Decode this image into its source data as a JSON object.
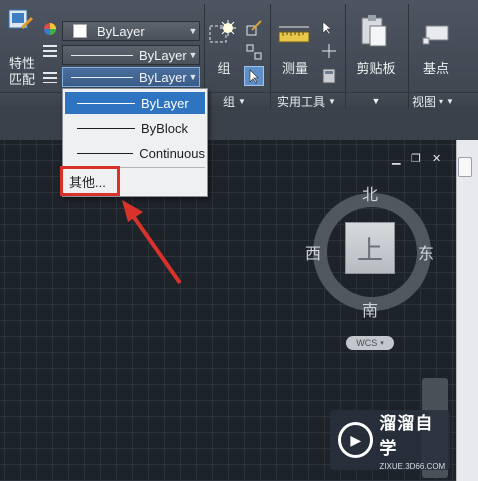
{
  "ribbon": {
    "match_properties_label_line1": "特性",
    "match_properties_label_line2": "匹配",
    "color_combo": {
      "value": "ByLayer"
    },
    "linetype_combo": {
      "value": "ByLayer"
    },
    "lineweight_combo": {
      "value": "ByLayer"
    },
    "group_label": "组",
    "measure_label": "测量",
    "clipboard_label": "剪贴板",
    "basepoint_label": "基点",
    "panels": {
      "group_panel": "组",
      "utilities_panel": "实用工具",
      "view_panel": "视图"
    }
  },
  "dropdown": {
    "items": [
      {
        "label": "ByLayer",
        "selected": true
      },
      {
        "label": "ByBlock",
        "selected": false
      },
      {
        "label": "Continuous",
        "selected": false
      }
    ],
    "other_label": "其他..."
  },
  "viewcube": {
    "north": "北",
    "south": "南",
    "east": "东",
    "west": "西",
    "top_face": "上",
    "wcs_label": "WCS"
  },
  "watermark": {
    "brand": "溜溜自学",
    "url": "ZIXUE.3D66.COM"
  },
  "colors": {
    "accent": "#2f74c0",
    "annotation_red": "#d8322b",
    "canvas_bg": "#1e2329"
  }
}
